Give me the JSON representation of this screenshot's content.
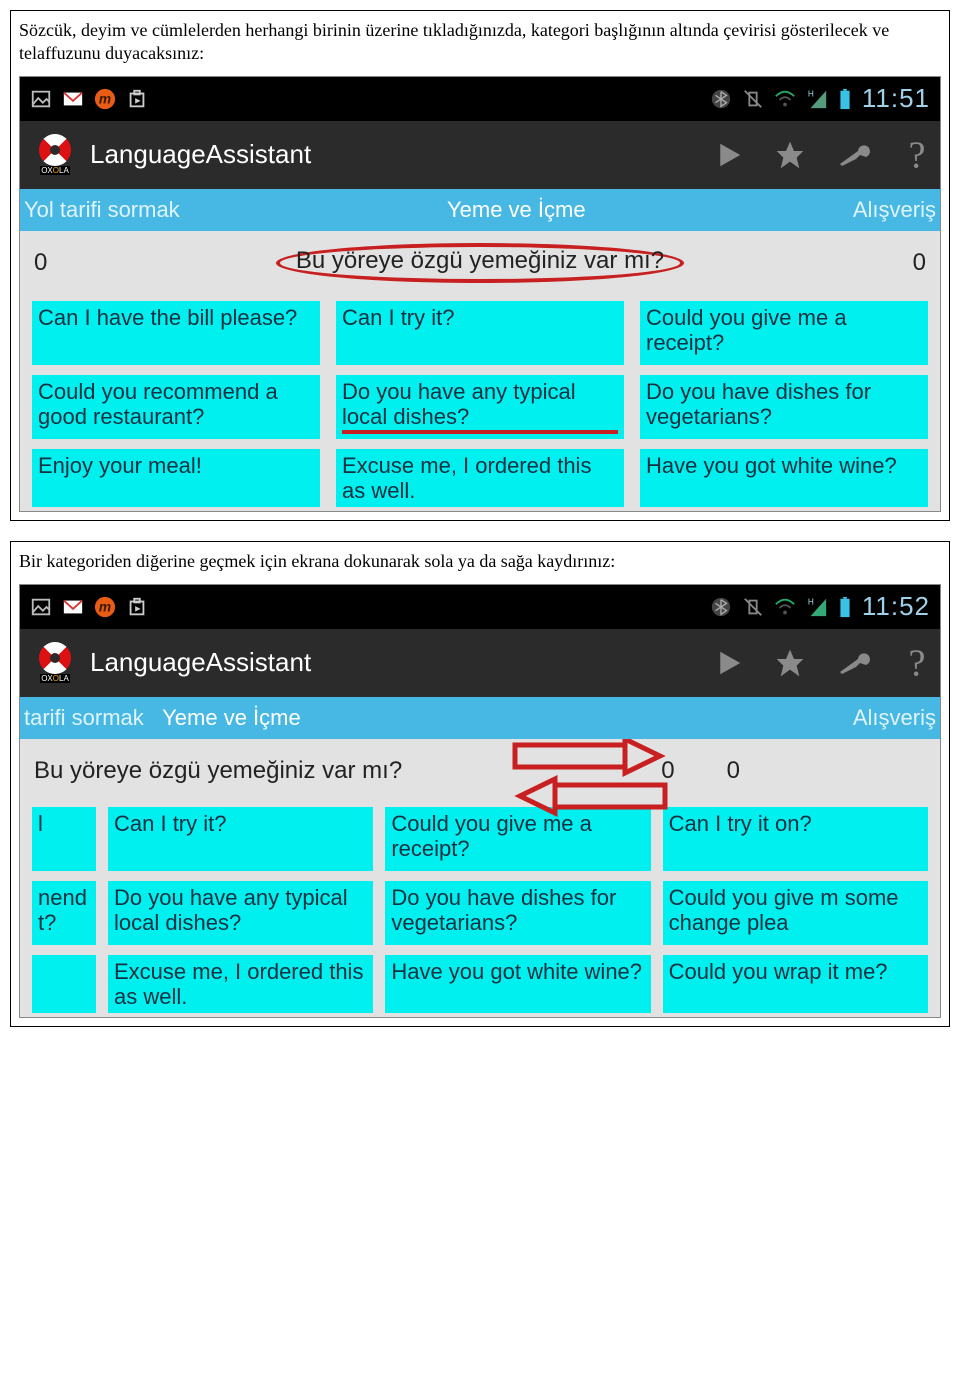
{
  "section1": {
    "intro": "Sözcük, deyim ve cümlelerden herhangi birinin üzerine tıkladığınızda, kategori başlığının altında çevirisi gösterilecek ve telaffuzunu duyacaksınız:",
    "status": {
      "time": "11:51"
    },
    "appTitle": "LanguageAssistant",
    "tabs": {
      "left": "Yol tarifi sormak",
      "center": "Yeme ve İçme",
      "right": "Alışveriş"
    },
    "trans": {
      "leftNum": "0",
      "text": "Bu yöreye özgü yemeğiniz var mı?",
      "rightNum": "0"
    },
    "phrases": [
      "Can I have the bill please?",
      "Can I try it?",
      "Could you give me a receipt?",
      "Could you recommend a good restaurant?",
      "Do you have any typical local dishes?",
      "Do you have dishes for vegetarians?",
      "Enjoy your meal!",
      "Excuse me, I ordered this as well.",
      "Have you got white wine?"
    ]
  },
  "section2": {
    "intro": "Bir kategoriden diğerine geçmek için ekrana dokunarak sola ya da sağa kaydırınız:",
    "status": {
      "time": "11:52"
    },
    "appTitle": "LanguageAssistant",
    "tabs": {
      "left": "tarifi sormak",
      "center": "Yeme ve İçme",
      "right": "Alışveriş"
    },
    "trans": {
      "text": "Bu yöreye özgü yemeğiniz var mı?",
      "z1": "0",
      "z2": "0"
    },
    "phrases": {
      "r1c0": "l",
      "r1c1": "Can I try it?",
      "r1c2": "Could you give me a receipt?",
      "r1c3": "Can I try it on?",
      "r2c0": "nend t?",
      "r2c0a": "nend",
      "r2c0b": "t?",
      "r2c1": "Do you have any typical local dishes?",
      "r2c2": "Do you have dishes for vegetarians?",
      "r2c3": "Could you give m some change plea",
      "r3c1": "Excuse me, I ordered this as well.",
      "r3c2": "Have you got white wine?",
      "r3c3": "Could you wrap it me?"
    }
  }
}
